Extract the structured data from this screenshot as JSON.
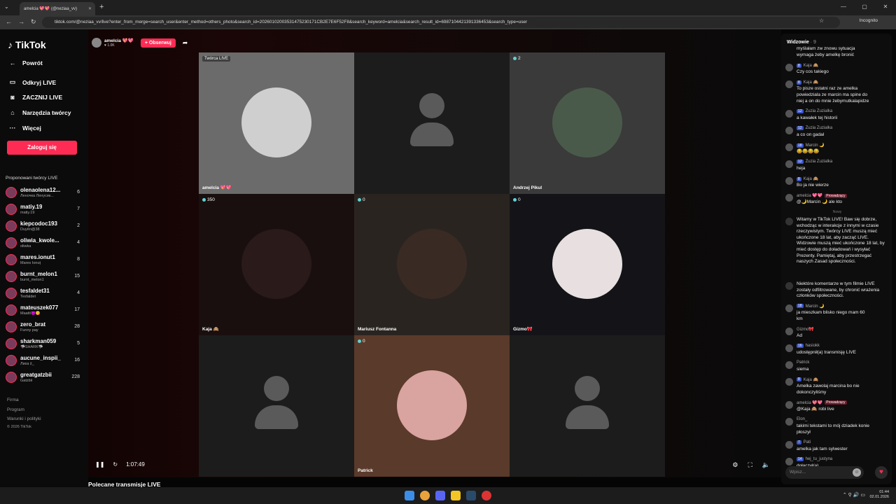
{
  "browser": {
    "tab_title": "amelcia 💖💖 (@neziaa_vv)",
    "url": "tiktok.com/@neziaa_vv/live?enter_from_merge=search_user&enter_method=others_photo&search_id=20260102003531475230171CB2E7E6F52F8&search_keyword=amelcia&search_result_id=6987104421391336453&search_type=user",
    "incognito_label": "Incognito"
  },
  "sidebar": {
    "logo": "TikTok",
    "nav": [
      {
        "label": "Powrót",
        "icon": "back-arrow-icon"
      },
      {
        "label": "Odkryj LIVE",
        "icon": "live-tv-icon"
      },
      {
        "label": "ZACZNIJ LIVE",
        "icon": "camera-icon"
      },
      {
        "label": "Narzędzia twórcy",
        "icon": "home-tools-icon"
      },
      {
        "label": "Więcej",
        "icon": "more-dots-icon"
      }
    ],
    "login_label": "Zaloguj się",
    "suggested_title": "Proponowani twórcy LIVE",
    "creators": [
      {
        "name": "olenaolena12...",
        "sub": "Леночка Ленусик...",
        "count": "6"
      },
      {
        "name": "matiy.19",
        "sub": "matiy.19",
        "count": "7"
      },
      {
        "name": "kiepcodoc193",
        "sub": "Duyên@38",
        "count": "2"
      },
      {
        "name": "oliwia_kwole...",
        "sub": "oliwka",
        "count": "4"
      },
      {
        "name": "mares.ionut1",
        "sub": "Mares Ionuț",
        "count": "8"
      },
      {
        "name": "burnt_melon1",
        "sub": "burnt_melon1",
        "count": "15"
      },
      {
        "name": "tesfaldet31",
        "sub": "Tesfaldet",
        "count": "4"
      },
      {
        "name": "mateuszek077",
        "sub": "Maatti😈😋",
        "count": "17"
      },
      {
        "name": "zero_brat",
        "sub": "Funny pay",
        "count": "28"
      },
      {
        "name": "sharkman059",
        "sub": "🦈SHARK🦈",
        "count": "5"
      },
      {
        "name": "aucune_inspii_",
        "sub": "Лиха ♯_",
        "count": "16"
      },
      {
        "name": "greatgatzbii",
        "sub": "Gatzbii",
        "count": "228"
      }
    ],
    "footer": [
      "Firma",
      "Program",
      "Warunki i polityki",
      "© 2026 TikTok"
    ]
  },
  "host": {
    "name": "amelcia 💖💖",
    "likes": "♥ 1.0K",
    "follow_label": "+ Obserwuj"
  },
  "guests": [
    {
      "label": "amelcia 💖💖",
      "badge": "Twórca LIVE",
      "count": "",
      "type": "photo"
    },
    {
      "label": "",
      "badge": "",
      "count": "",
      "type": "empty"
    },
    {
      "label": "Andrzej Pikul",
      "badge": "",
      "count": "2",
      "type": "photo"
    },
    {
      "label": "Kaja 🙈",
      "badge": "",
      "count": "350",
      "type": "photo"
    },
    {
      "label": "Mariusz Fontanna",
      "badge": "",
      "count": "0",
      "type": "photo"
    },
    {
      "label": "Gizmo🎀",
      "badge": "",
      "count": "0",
      "type": "photo"
    },
    {
      "label": "",
      "badge": "",
      "count": "",
      "type": "empty"
    },
    {
      "label": "Patrick",
      "badge": "",
      "count": "0",
      "type": "photo"
    },
    {
      "label": "",
      "badge": "",
      "count": "",
      "type": "empty"
    }
  ],
  "player": {
    "time": "1:07:49"
  },
  "recommended_title": "Polecane transmisje LIVE",
  "chat": {
    "title": "Widzowie",
    "viewers": "· 9",
    "divider": "Nowy",
    "input_placeholder": "Wpisz...",
    "messages": [
      {
        "user": "",
        "level": "",
        "text": "myślałam zw znowu sytuacja",
        "text2": "wymaga żeby amelkę bronić"
      },
      {
        "user": "Kaja 🙈",
        "level": "8",
        "text": "Czy cos takiego",
        "text2": ""
      },
      {
        "user": "Kaja 🙈",
        "level": "8",
        "text": "To pisze ostatni raz ze amelka",
        "text2": "powiedziala ze marcin ma spine do"
      },
      {
        "user": "Zuzia Zuzialka",
        "level": "12",
        "text": "a kawałek tej historii",
        "text2": ""
      },
      {
        "user": "Zuzia Zuzialka",
        "level": "12",
        "text": "a co on gadał",
        "text2": ""
      },
      {
        "user": "Marcin 🌙",
        "level": "18",
        "text": "😂😂😂😂",
        "text2": ""
      },
      {
        "user": "Zuzia Zuzialka",
        "level": "12",
        "text": "heja",
        "text2": ""
      },
      {
        "user": "Kaja 🙈",
        "level": "8",
        "text": "Bo ja nie wierze",
        "text2": ""
      },
      {
        "user": "amelcia 💖💖",
        "level": "",
        "text": "@🌙Marcin 🌙 ale kto",
        "text2": ""
      }
    ],
    "extra_line": "niej a on do mnie żebymutkalapidze",
    "mod_badge": "Prowadzący",
    "system_msg": "Witamy w TikTok LIVE! Baw się dobrze, wchodząc w interakcje z innymi w czasie rzeczywistym. Twórcy LIVE muszą mieć ukończone 18 lat, aby zacząć LIVE. Widzowie muszą mieć ukończone 18 lat, by mieć dostęp do doładowań i wysyłać Prezenty. Pamiętaj, aby przestrzegać naszych Zasad społeczności.",
    "filter_msg": "Niektóre komentarze w tym filmie LIVE zostały odfiltrowane, by chronić wrażenia członków społeczności.",
    "messages2": [
      {
        "user": "Marcin 🌙",
        "level": "18",
        "text": "ja mieszkam blisko niego mam 60",
        "text2": "km"
      },
      {
        "user": "Gizmo🎀",
        "level": "",
        "text": "Ad",
        "text2": ""
      },
      {
        "user": "hasiokk",
        "level": "16",
        "text": "udostępnił(a) transmisję LIVE",
        "text2": ""
      },
      {
        "user": "Patrick",
        "level": "",
        "text": "siema",
        "text2": ""
      },
      {
        "user": "Kaja 🙈",
        "level": "8",
        "text": "Amelka zawolaj marcina bo nie",
        "text2": "dokonczyliśmy"
      },
      {
        "user": "amelcia 💖💖",
        "level": "",
        "text": "@Kaja 🙈 robi live",
        "text2": ""
      },
      {
        "user": "Elon_",
        "level": "",
        "text": "takimi tekstami to mój dziadek konie",
        "text2": "płoszył"
      },
      {
        "user": "Pati",
        "level": "7",
        "text": "amelka jak tam sylwester",
        "text2": ""
      },
      {
        "user": "hej_tu_justyna",
        "level": "14",
        "text": "dołączył(a)",
        "text2": ""
      }
    ]
  },
  "taskbar": {
    "time": "01:44",
    "date": "02.01.2026"
  }
}
